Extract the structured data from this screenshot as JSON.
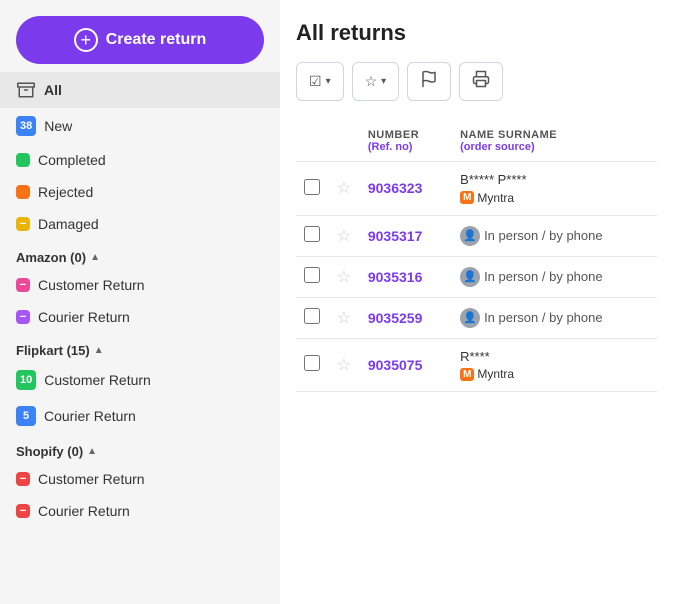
{
  "sidebar": {
    "create_button_label": "Create return",
    "all_label": "All",
    "status_items": [
      {
        "id": "new",
        "label": "New",
        "badge_text": "38",
        "badge_class": "badge-blue"
      },
      {
        "id": "completed",
        "label": "Completed",
        "badge_text": "",
        "badge_class": "badge-green"
      },
      {
        "id": "rejected",
        "label": "Rejected",
        "badge_text": "",
        "badge_class": "badge-orange"
      },
      {
        "id": "damaged",
        "label": "Damaged",
        "badge_text": "",
        "badge_class": "badge-yellow"
      }
    ],
    "sections": [
      {
        "id": "amazon",
        "label": "Amazon (0)",
        "items": [
          {
            "id": "amazon-customer",
            "label": "Customer Return",
            "badge_text": "",
            "badge_class": "badge-pink"
          },
          {
            "id": "amazon-courier",
            "label": "Courier Return",
            "badge_text": "",
            "badge_class": "badge-purple"
          }
        ]
      },
      {
        "id": "flipkart",
        "label": "Flipkart (15)",
        "items": [
          {
            "id": "flipkart-customer",
            "label": "Customer Return",
            "badge_text": "10",
            "badge_class": "badge-green"
          },
          {
            "id": "flipkart-courier",
            "label": "Courier Return",
            "badge_text": "5",
            "badge_class": "badge-blue"
          }
        ]
      },
      {
        "id": "shopify",
        "label": "Shopify (0)",
        "items": [
          {
            "id": "shopify-customer",
            "label": "Customer Return",
            "badge_text": "",
            "badge_class": "badge-red"
          },
          {
            "id": "shopify-courier",
            "label": "Courier Return",
            "badge_text": "",
            "badge_class": "badge-red"
          }
        ]
      }
    ]
  },
  "main": {
    "title": "All returns",
    "toolbar": {
      "checkbox_btn_label": "☑",
      "star_btn_label": "☆",
      "flag_icon": "⚑",
      "print_icon": "🖨"
    },
    "table": {
      "columns": [
        {
          "id": "number",
          "label": "NUMBER",
          "sublabel": "(Ref. no)"
        },
        {
          "id": "name",
          "label": "NAME SURNAME",
          "sublabel": "(order source)"
        }
      ],
      "rows": [
        {
          "id": 1,
          "number": "9036323",
          "name": "B***** P****",
          "source": "Myntra",
          "source_type": "marketplace"
        },
        {
          "id": 2,
          "number": "9035317",
          "name": "",
          "source": "In person / by phone",
          "source_type": "person"
        },
        {
          "id": 3,
          "number": "9035316",
          "name": "",
          "source": "In person / by phone",
          "source_type": "person"
        },
        {
          "id": 4,
          "number": "9035259",
          "name": "",
          "source": "In person / by phone",
          "source_type": "person"
        },
        {
          "id": 5,
          "number": "9035075",
          "name": "R****",
          "source": "Myntra",
          "source_type": "marketplace"
        }
      ]
    }
  },
  "icons": {
    "plus": "+",
    "chevron_down": "▾",
    "inbox": "📥"
  }
}
